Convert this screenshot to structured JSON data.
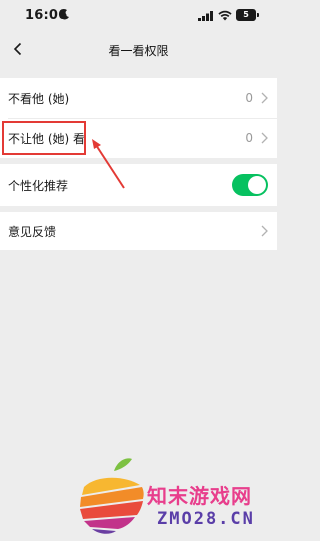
{
  "status_bar": {
    "time": "16:06",
    "battery": "5",
    "icons": [
      "moon-icon",
      "signal-icon",
      "wifi-icon",
      "battery-icon"
    ]
  },
  "nav": {
    "title": "看一看权限",
    "back_icon": "chevron-left-icon"
  },
  "settings": {
    "privacy_group": [
      {
        "label": "不看他 (她)",
        "value": "0"
      },
      {
        "label": "不让他 (她) 看",
        "value": "0"
      }
    ],
    "recommend": {
      "label": "个性化推荐",
      "enabled": true
    },
    "feedback": {
      "label": "意见反馈"
    }
  },
  "annotation": {
    "highlight_color": "#e33a35"
  },
  "watermark": {
    "cn": "知末游戏网",
    "en": "ZMO28.CN"
  },
  "colors": {
    "background": "#ededed",
    "toggle_on": "#07c160",
    "annotation_red": "#e33a35"
  }
}
